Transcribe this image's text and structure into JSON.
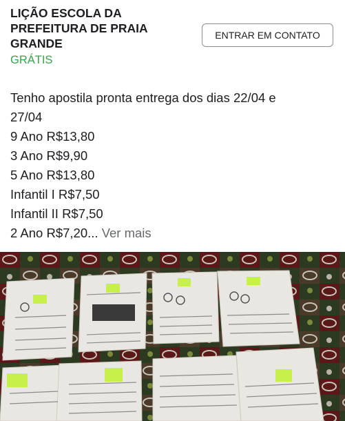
{
  "listing": {
    "title_line1": "LIÇÃO ESCOLA DA",
    "title_line2": "PREFEITURA DE PRAIA",
    "title_line3": "GRANDE",
    "price": "GRÁTIS",
    "contact_button": "ENTRAR EM CONTATO"
  },
  "description": {
    "line1": "Tenho apostila pronta entrega dos dias 22/04 e",
    "line2": "27/04",
    "line3": "9 Ano R$13,80",
    "line4": "3 Ano R$9,90",
    "line5": "5 Ano R$13,80",
    "line6": "Infantil I R$7,50",
    "line7": "Infantil II R$7,50",
    "line8": "2 Ano R$7,20...",
    "see_more": "Ver mais"
  },
  "photo": {
    "icon": "photo-worksheets-on-patterned-fabric"
  }
}
